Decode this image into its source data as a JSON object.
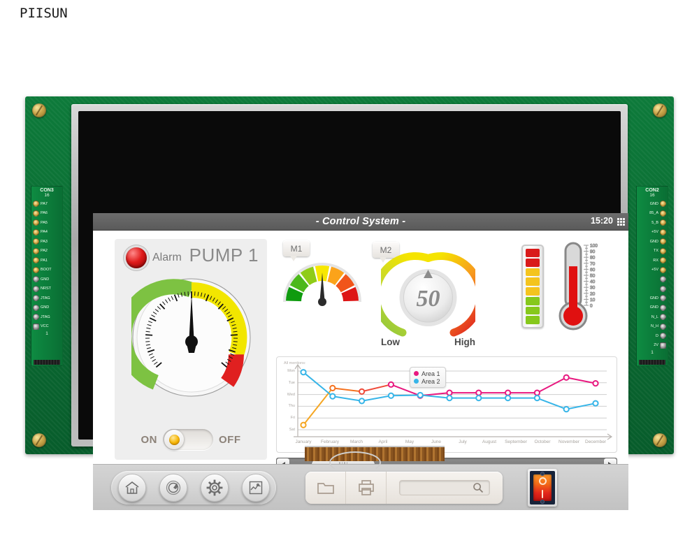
{
  "watermark": "PIISUN",
  "hardware": {
    "left_connector": {
      "name": "CON3",
      "top_num": "16",
      "bottom_num": "1",
      "pins": [
        "PA7",
        "PA6",
        "PA5",
        "PA4",
        "PA3",
        "PA2",
        "PA1",
        "BOOT",
        "GND",
        "NRST",
        "JTAG",
        "GND",
        "JTAG",
        "VCC"
      ]
    },
    "right_connector": {
      "name": "CON2",
      "top_num": "16",
      "bottom_num": "1",
      "pins": [
        "GND",
        "85_A",
        "5_B",
        "+5V",
        "GND",
        "TX",
        "RX",
        "+5V",
        "",
        "",
        "GND",
        "GND",
        "N_L",
        "N_H",
        "D",
        "2V"
      ]
    }
  },
  "titlebar": {
    "title": "- Control System -",
    "clock": "15:20",
    "grid_icon": "grid-icon"
  },
  "pump_panel": {
    "alarm_label": "Alarm",
    "alarm_led_color": "#e01b1b",
    "title": "PUMP 1",
    "gauge": {
      "needle_value": 50,
      "zones": [
        {
          "label": "green",
          "color": "#7dc242",
          "from": 0,
          "to": 50
        },
        {
          "label": "yellow",
          "color": "#f2e600",
          "from": 50,
          "to": 80
        },
        {
          "label": "red",
          "color": "#e02020",
          "from": 80,
          "to": 100
        }
      ]
    },
    "toggle": {
      "on_label": "ON",
      "off_label": "OFF",
      "state": "ON",
      "knob_color": "#f7b500"
    }
  },
  "m1": {
    "tag": "M1",
    "needle_value": 52,
    "segments": [
      "#0f9b0f",
      "#4cb81b",
      "#8fcc18",
      "#f7e700",
      "#fba31a",
      "#f1551a",
      "#dd1515"
    ]
  },
  "m2": {
    "tag": "M2",
    "value": "50",
    "low_label": "Low",
    "high_label": "High",
    "marker": "up-triangle"
  },
  "ledbar": {
    "segments": [
      "#d91a1a",
      "#d91a1a",
      "#f4c41e",
      "#f4c41e",
      "#f4c41e",
      "#86c81b",
      "#86c81b",
      "#86c81b"
    ]
  },
  "thermometer": {
    "ticks": [
      "100",
      "90",
      "80",
      "70",
      "60",
      "50",
      "40",
      "30",
      "20",
      "10",
      "0"
    ],
    "value": 65,
    "mercury_color": "#e01010"
  },
  "chart_data": {
    "type": "line",
    "title": "",
    "note": "All mentions:",
    "xlabel": "",
    "ylabel": "",
    "grid": true,
    "legend_position": "top-center",
    "categories": [
      "January",
      "February",
      "March",
      "April",
      "May",
      "June",
      "July",
      "August",
      "September",
      "October",
      "November",
      "December"
    ],
    "ytick_labels": [
      "Mon",
      "Tue",
      "Wed",
      "Thu",
      "Fri",
      "Sat"
    ],
    "ylim": [
      0,
      5
    ],
    "series": [
      {
        "name": "Area 1",
        "color": "#e8187f",
        "line_colors": [
          "#f5a623",
          "#f5721f",
          "#ef4b3a",
          "#e8187f"
        ],
        "values": [
          4.6,
          1.45,
          1.75,
          1.15,
          2.1,
          1.85,
          1.85,
          1.85,
          1.85,
          0.55,
          1.05
        ]
      },
      {
        "name": "Area 2",
        "color": "#37b5e8",
        "line_colors": [
          "#37b5e8"
        ],
        "values": [
          0.1,
          2.15,
          2.55,
          2.1,
          2.05,
          2.3,
          2.3,
          2.3,
          2.3,
          3.25,
          2.75
        ]
      }
    ]
  },
  "scrollbar": {
    "left_arrow": "left-arrow-icon",
    "right_arrow": "right-arrow-icon",
    "thumb_position_pct": 4
  },
  "bottom_bar": {
    "round_buttons": [
      {
        "name": "home-button",
        "icon": "home-icon"
      },
      {
        "name": "gauge-button",
        "icon": "speedometer-icon"
      },
      {
        "name": "settings-button",
        "icon": "gear-icon"
      },
      {
        "name": "trend-button",
        "icon": "chart-icon"
      }
    ],
    "tool_buttons": [
      {
        "name": "open-folder-button",
        "icon": "folder-icon"
      },
      {
        "name": "print-button",
        "icon": "printer-icon"
      }
    ],
    "search": {
      "value": "",
      "placeholder": "",
      "icon": "search-icon"
    },
    "power_switch": {
      "off_label": "O",
      "on_label": "I",
      "state": "off"
    }
  }
}
